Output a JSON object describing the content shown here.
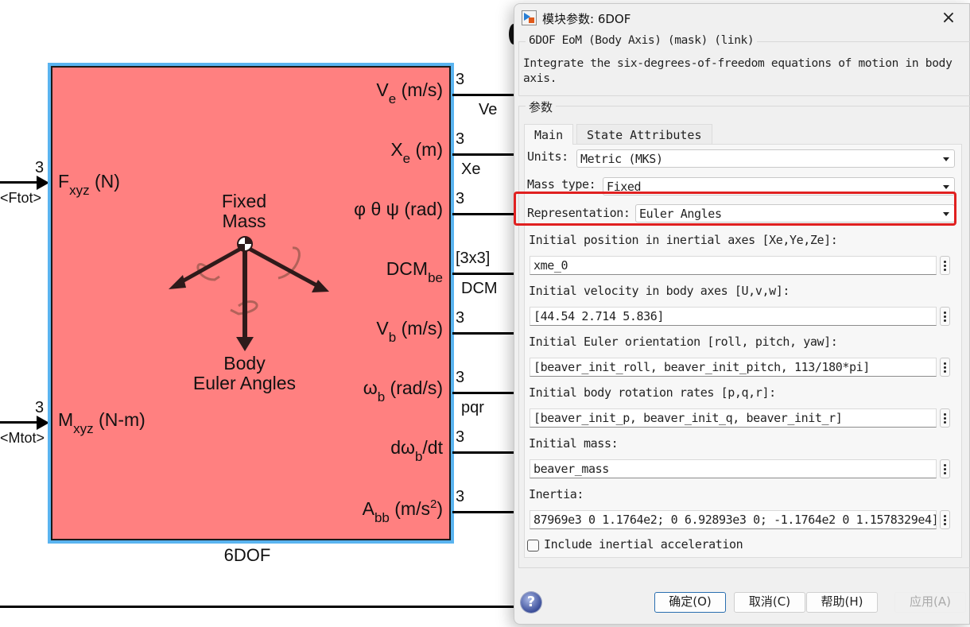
{
  "canvas": {
    "block": {
      "name": "6DOF",
      "fill_color": "#ff8080",
      "selection_color": "#5ab4f0",
      "icon_text_top": [
        "Fixed",
        "Mass"
      ],
      "icon_text_bottom": [
        "Body",
        "Euler Angles"
      ],
      "inputs": [
        {
          "label_main": "F",
          "label_sub": "xyz",
          "label_rest": " (N)",
          "dim": "3",
          "signal": "<Ftot>"
        },
        {
          "label_main": "M",
          "label_sub": "xyz",
          "label_rest": " (N-m)",
          "dim": "3",
          "signal": "<Mtot>"
        }
      ],
      "outputs": [
        {
          "label_main": "V",
          "label_sub": "e",
          "label_rest": " (m/s)",
          "dim": "3",
          "signal": "Ve"
        },
        {
          "label_main": "X",
          "label_sub": "e",
          "label_rest": " (m)",
          "dim": "3",
          "signal": "Xe"
        },
        {
          "label_main": "φ θ ψ (rad)",
          "label_sub": "",
          "label_rest": "",
          "dim": "3",
          "signal": ""
        },
        {
          "label_main": "DCM",
          "label_sub": "be",
          "label_rest": "",
          "dim": "[3x3]",
          "signal": "DCM"
        },
        {
          "label_main": "V",
          "label_sub": "b",
          "label_rest": " (m/s)",
          "dim": "3",
          "signal": ""
        },
        {
          "label_main": "ω",
          "label_sub": "b",
          "label_rest": " (rad/s)",
          "dim": "3",
          "signal": "pqr"
        },
        {
          "label_main": "dω",
          "label_sub": "b",
          "label_rest": "/dt",
          "dim": "3",
          "signal": ""
        },
        {
          "label_main": "A",
          "label_sub": "bb",
          "label_rest": " (m/s",
          "label_sup": "2",
          "label_end": ")",
          "dim": "3",
          "signal": ""
        }
      ]
    }
  },
  "dialog": {
    "title": "模块参数: 6DOF",
    "close_icon": "×",
    "mask_title": "6DOF EoM (Body Axis) (mask) (link)",
    "mask_description": "Integrate the six-degrees-of-freedom equations of motion in body axis.",
    "params_legend": "参数",
    "tabs": [
      {
        "label": "Main",
        "active": true
      },
      {
        "label": "State Attributes",
        "active": false
      }
    ],
    "units": {
      "label": "Units:",
      "value": "Metric (MKS)"
    },
    "mass_type": {
      "label": "Mass type:",
      "value": "Fixed"
    },
    "representation": {
      "label": "Representation:",
      "value": "Euler Angles",
      "highlighted": true,
      "highlight_color": "#e02020"
    },
    "fields": [
      {
        "label": "Initial position in inertial axes [Xe,Ye,Ze]:",
        "value": "xme_0"
      },
      {
        "label": "Initial velocity in body axes [U,v,w]:",
        "value": "[44.54 2.714 5.836]"
      },
      {
        "label": "Initial Euler orientation [roll, pitch, yaw]:",
        "value": "[beaver_init_roll, beaver_init_pitch, 113/180*pi]"
      },
      {
        "label": "Initial body rotation rates [p,q,r]:",
        "value": "[beaver_init_p, beaver_init_q, beaver_init_r]"
      },
      {
        "label": "Initial mass:",
        "value": "beaver_mass"
      },
      {
        "label": "Inertia:",
        "value": "87969e3  0 1.1764e2; 0 6.92893e3 0; -1.1764e2 0 1.1578329e4]"
      }
    ],
    "include_inertial_accel": {
      "label": "Include inertial acceleration",
      "checked": false
    },
    "buttons": {
      "ok": "确定(O)",
      "cancel": "取消(C)",
      "help": "帮助(H)",
      "apply": "应用(A)"
    },
    "help_icon": "?"
  }
}
